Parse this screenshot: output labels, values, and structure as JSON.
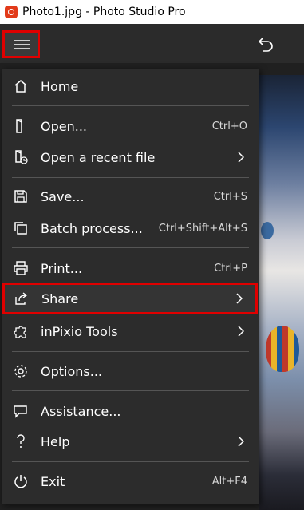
{
  "window": {
    "title": "Photo1.jpg - Photo Studio Pro"
  },
  "toolbar": {
    "menu_icon": "hamburger-icon",
    "undo_icon": "undo-icon"
  },
  "colors": {
    "highlight": "#e00000",
    "menu_bg": "#2c2c2c",
    "app_icon": "#e23a1a"
  },
  "menu": {
    "home": {
      "label": "Home",
      "icon": "home-icon"
    },
    "open": {
      "label": "Open...",
      "shortcut": "Ctrl+O",
      "icon": "open-file-icon"
    },
    "recent": {
      "label": "Open a recent file",
      "icon": "recent-file-icon"
    },
    "save": {
      "label": "Save...",
      "shortcut": "Ctrl+S",
      "icon": "save-icon"
    },
    "batch": {
      "label": "Batch process...",
      "shortcut": "Ctrl+Shift+Alt+S",
      "icon": "batch-icon"
    },
    "print": {
      "label": "Print...",
      "shortcut": "Ctrl+P",
      "icon": "print-icon"
    },
    "share": {
      "label": "Share",
      "icon": "share-icon"
    },
    "inpixio": {
      "label": "inPixio Tools",
      "icon": "puzzle-icon"
    },
    "options": {
      "label": "Options...",
      "icon": "gear-icon"
    },
    "assistance": {
      "label": "Assistance...",
      "icon": "chat-icon"
    },
    "help": {
      "label": "Help",
      "icon": "question-icon"
    },
    "exit": {
      "label": "Exit",
      "shortcut": "Alt+F4",
      "icon": "power-icon"
    }
  }
}
